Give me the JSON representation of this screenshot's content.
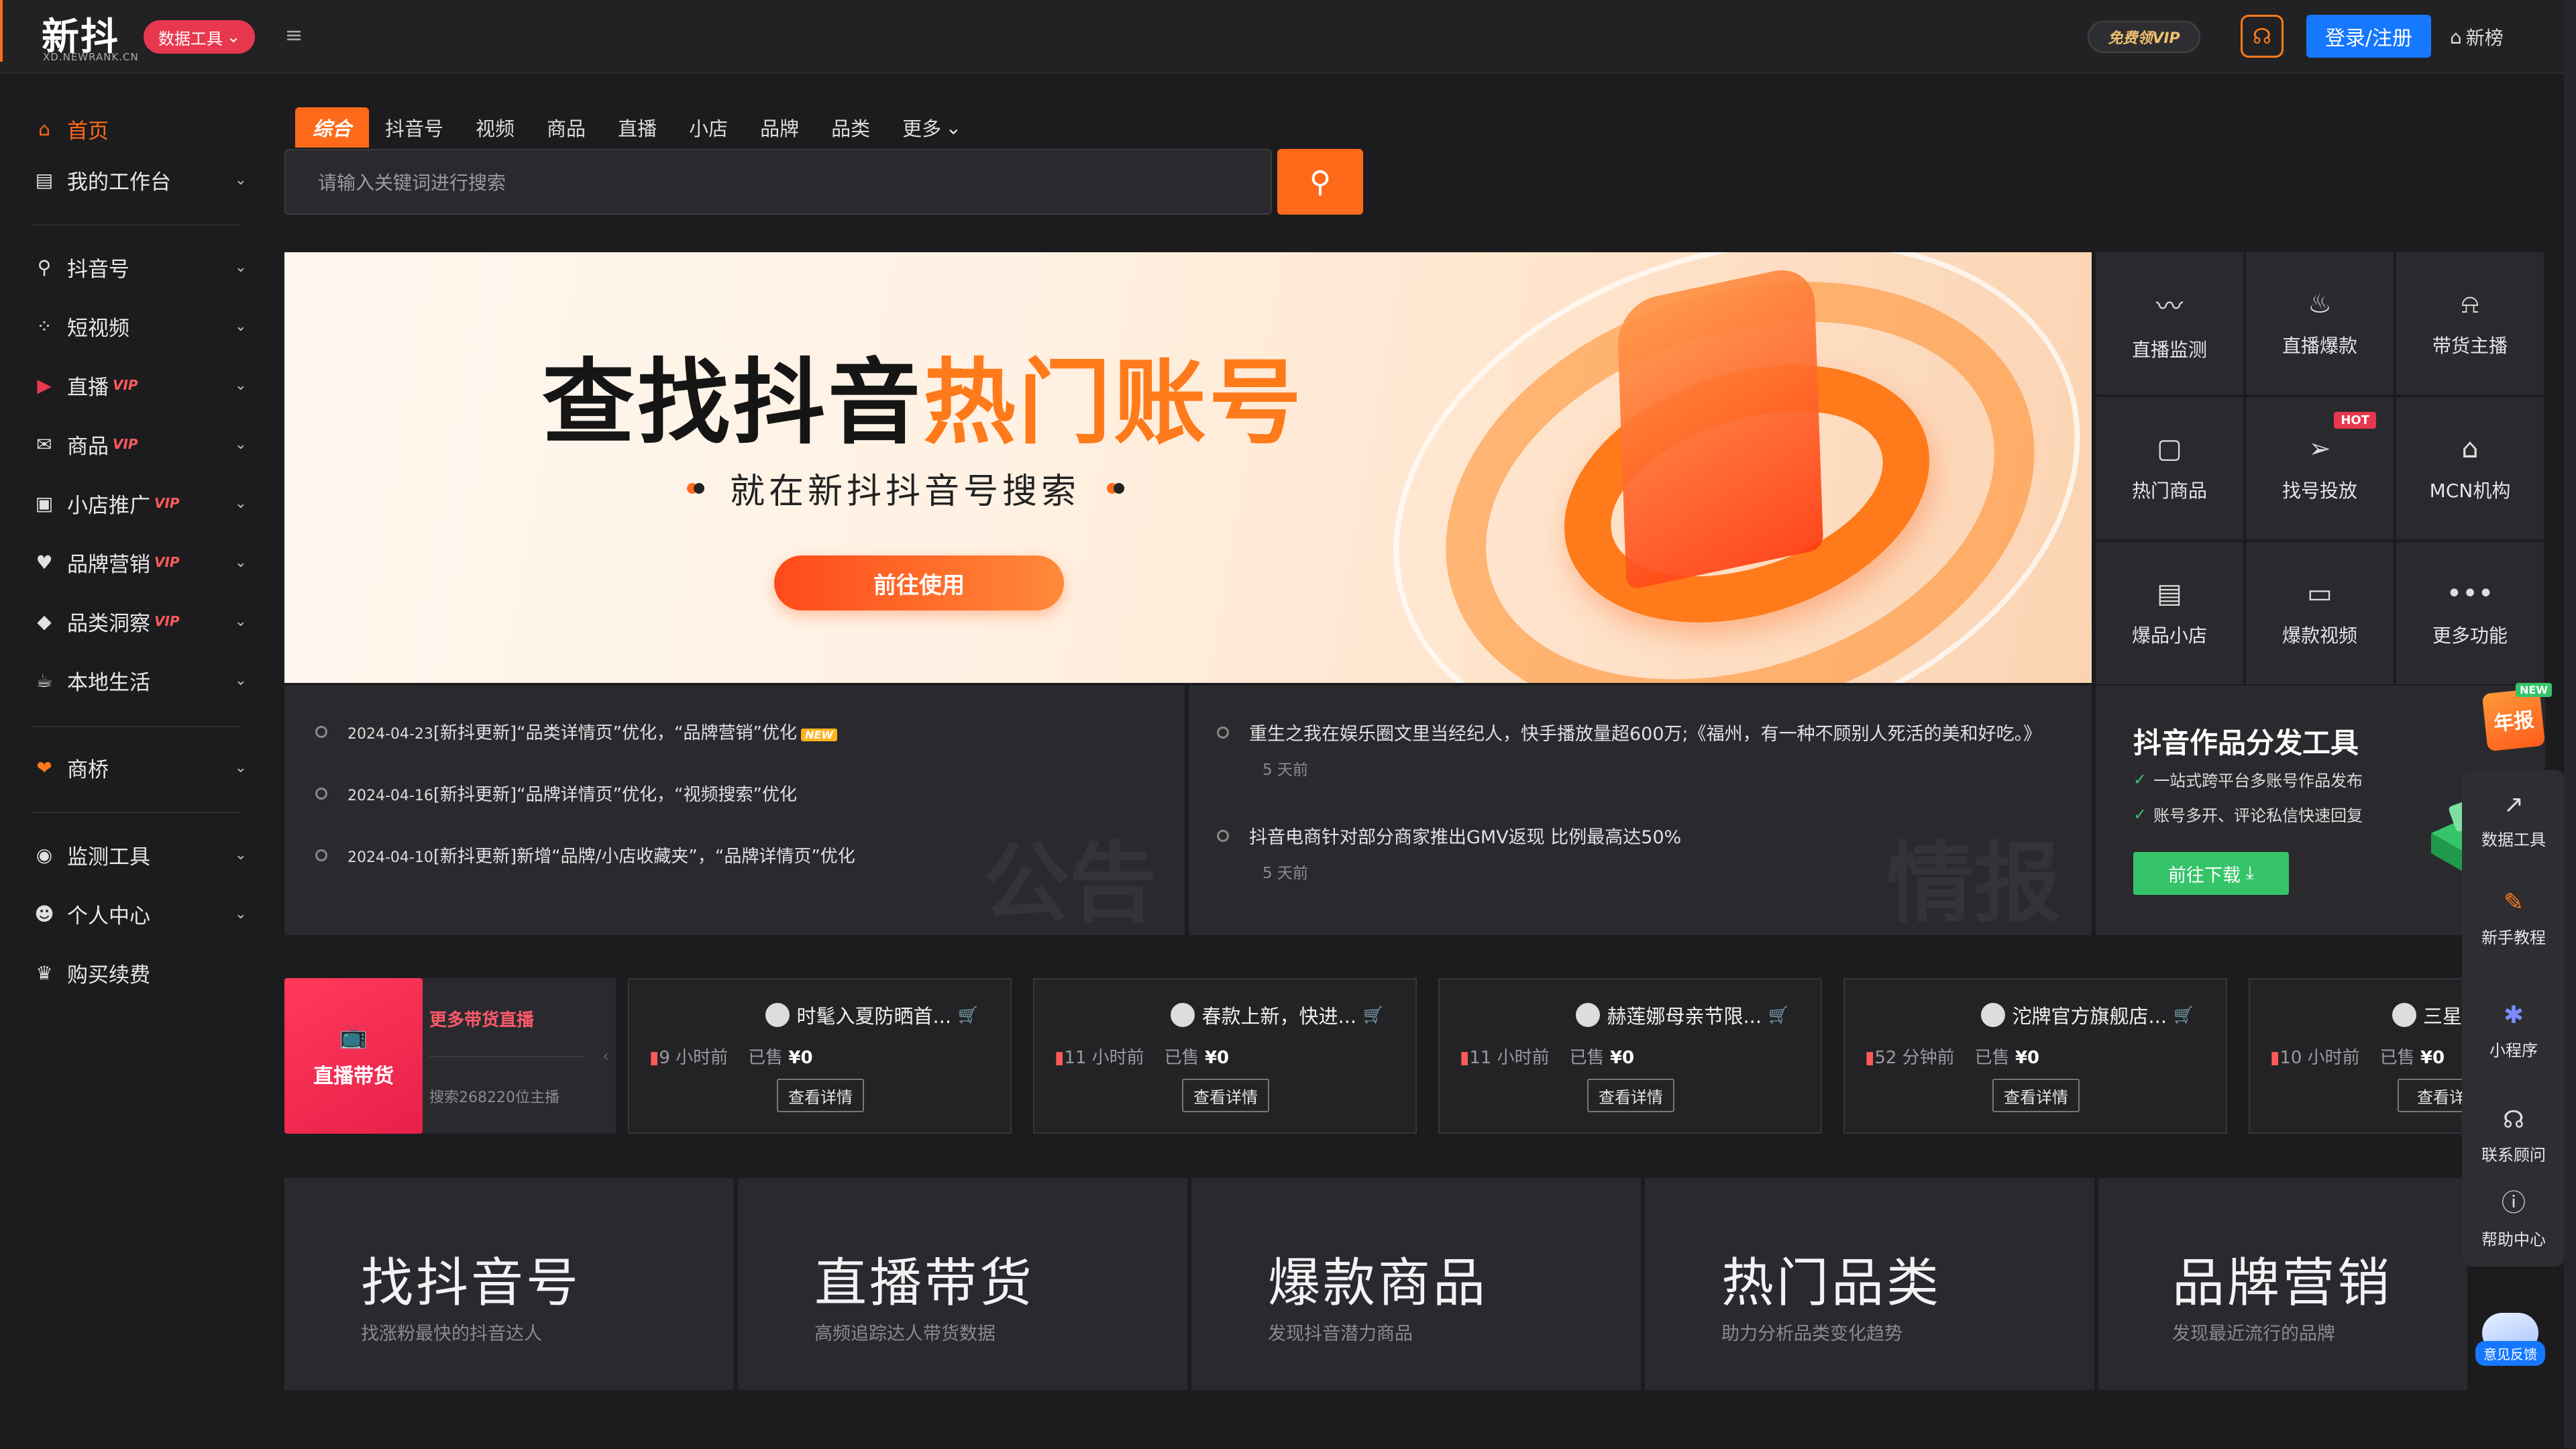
{
  "app": {
    "logo_text": "新抖",
    "logo_sub": "XD.NEWRANK.CN",
    "tools_pill": "数据工具",
    "vip_pill": "免费领VIP",
    "login": "登录/注册",
    "rank_link": "新榜"
  },
  "sidebar": {
    "items": [
      {
        "label": "首页",
        "icon": "home-icon",
        "glyph": "⌂"
      },
      {
        "label": "我的工作台",
        "icon": "dashboard-icon",
        "glyph": "▤"
      },
      {
        "label": "抖音号",
        "icon": "search-icon",
        "glyph": "⚲"
      },
      {
        "label": "短视频",
        "icon": "grid-icon",
        "glyph": "⁘"
      },
      {
        "label": "直播",
        "icon": "live-icon",
        "glyph": "▶",
        "vip": "VIP"
      },
      {
        "label": "商品",
        "icon": "goods-icon",
        "glyph": "✉",
        "vip": "VIP"
      },
      {
        "label": "小店推广",
        "icon": "shop-icon",
        "glyph": "▣",
        "vip": "VIP"
      },
      {
        "label": "品牌营销",
        "icon": "brand-icon",
        "glyph": "♥",
        "vip": "VIP"
      },
      {
        "label": "品类洞察",
        "icon": "tag-icon",
        "glyph": "◆",
        "vip": "VIP"
      },
      {
        "label": "本地生活",
        "icon": "local-icon",
        "glyph": "☕"
      },
      {
        "label": "商桥",
        "icon": "bridge-icon",
        "glyph": "❤"
      },
      {
        "label": "监测工具",
        "icon": "monitor-icon",
        "glyph": "◉"
      },
      {
        "label": "个人中心",
        "icon": "user-icon",
        "glyph": "☻"
      },
      {
        "label": "购买续费",
        "icon": "crown-icon",
        "glyph": "♛"
      }
    ]
  },
  "search": {
    "tabs": [
      "综合",
      "抖音号",
      "视频",
      "商品",
      "直播",
      "小店",
      "品牌",
      "品类",
      "更多"
    ],
    "placeholder": "请输入关键词进行搜索"
  },
  "banner": {
    "title_main": "查找抖音",
    "title_highlight": "热门账号",
    "subtitle": "就在新抖抖音号搜索",
    "cta": "前往使用"
  },
  "quick_grid": [
    {
      "label": "直播监测",
      "glyph": "〰"
    },
    {
      "label": "直播爆款",
      "glyph": "♨"
    },
    {
      "label": "带货主播",
      "glyph": "🎙"
    },
    {
      "label": "热门商品",
      "glyph": "▢"
    },
    {
      "label": "找号投放",
      "glyph": "➢",
      "badge": "HOT"
    },
    {
      "label": "MCN机构",
      "glyph": "⌂"
    },
    {
      "label": "爆品小店",
      "glyph": "▤"
    },
    {
      "label": "爆款视频",
      "glyph": "▭"
    },
    {
      "label": "更多功能",
      "glyph": "•••"
    }
  ],
  "announcements": {
    "watermark": "公告",
    "items": [
      {
        "date": "2024-04-23",
        "text": "[新抖更新]“品类详情页”优化，“品牌营销”优化",
        "badge": "NEW"
      },
      {
        "date": "2024-04-16",
        "text": "[新抖更新]“品牌详情页”优化，“视频搜索”优化"
      },
      {
        "date": "2024-04-10",
        "text": "[新抖更新]新增“品牌/小店收藏夹”，“品牌详情页”优化"
      }
    ]
  },
  "intel": {
    "watermark": "情报",
    "items": [
      {
        "text": "重生之我在娱乐圈文里当经纪人，快手播放量超600万;《福州，有一种不顾别人死活的美和好吃。》",
        "time": "5 天前"
      },
      {
        "text": "抖音电商针对部分商家推出GMV返现 比例最高达50%",
        "time": "5 天前"
      }
    ]
  },
  "tool_promo": {
    "title": "抖音作品分发工具",
    "features": [
      "一站式跨平台多账号作品发布",
      "账号多开、评论私信快速回复"
    ],
    "button": "前往下载"
  },
  "right_rail": {
    "annual": "年报",
    "annual_badge": "NEW",
    "items": [
      {
        "label": "数据工具",
        "glyph": "📈"
      },
      {
        "label": "新手教程",
        "glyph": "✎"
      },
      {
        "label": "小程序",
        "glyph": "✱"
      },
      {
        "label": "联系顾问",
        "glyph": "☊"
      },
      {
        "label": "帮助中心",
        "glyph": "?"
      }
    ],
    "feedback": "意见反馈"
  },
  "live": {
    "hero_label": "直播带货",
    "more_label": "更多带货直播",
    "count_label": "搜索268220位主播",
    "cards": [
      {
        "title": "时髦入夏防晒首...",
        "ago": "9 小时前",
        "sold_label": "已售",
        "sold": "¥0",
        "button": "查看详情"
      },
      {
        "title": "春款上新，快进...",
        "ago": "11 小时前",
        "sold_label": "已售",
        "sold": "¥0",
        "button": "查看详情"
      },
      {
        "title": "赫莲娜母亲节限...",
        "ago": "11 小时前",
        "sold_label": "已售",
        "sold": "¥0",
        "button": "查看详情"
      },
      {
        "title": "沱牌官方旗舰店...",
        "ago": "52 分钟前",
        "sold_label": "已售",
        "sold": "¥0",
        "button": "查看详情"
      },
      {
        "title": "三星",
        "ago": "10 小时前",
        "sold_label": "已售",
        "sold": "¥0",
        "button": "查看详"
      }
    ]
  },
  "categories": [
    {
      "title": "找抖音号",
      "sub": "找涨粉最快的抖音达人"
    },
    {
      "title": "直播带货",
      "sub": "高频追踪达人带货数据"
    },
    {
      "title": "爆款商品",
      "sub": "发现抖音潜力商品"
    },
    {
      "title": "热门品类",
      "sub": "助力分析品类变化趋势"
    },
    {
      "title": "品牌营销",
      "sub": "发现最近流行的品牌"
    }
  ]
}
